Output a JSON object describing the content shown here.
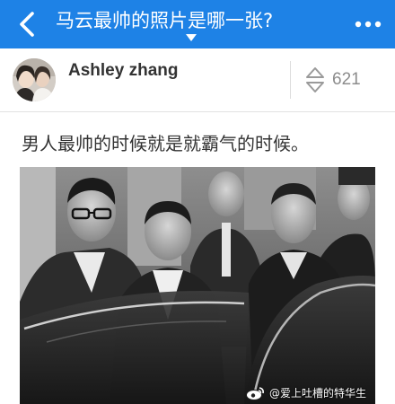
{
  "nav": {
    "title": "马云最帅的照片是哪一张?",
    "back_icon": "chevron-left-icon",
    "more_icon": "more-dots-icon",
    "background": "#1e82e6"
  },
  "answer": {
    "author": "Ashley zhang",
    "vote_count": "621",
    "text": "男人最帅的时候就是就霸气的时候。"
  },
  "photo": {
    "watermark": "@爱上吐槽的特华生",
    "watermark_icon": "weibo-icon"
  }
}
